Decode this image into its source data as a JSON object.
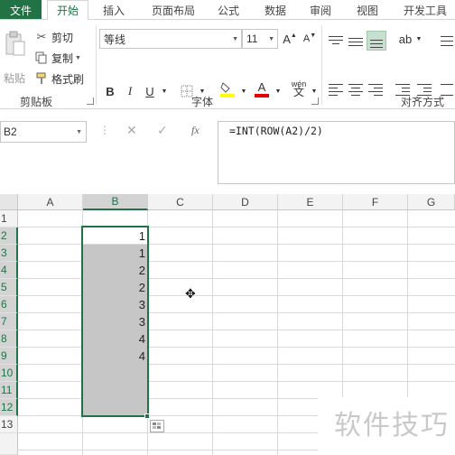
{
  "tabs": {
    "file": "文件",
    "items": [
      {
        "label": "开始",
        "active": true
      },
      {
        "label": "插入"
      },
      {
        "label": "页面布局"
      },
      {
        "label": "公式"
      },
      {
        "label": "数据"
      },
      {
        "label": "审阅"
      },
      {
        "label": "视图"
      },
      {
        "label": "开发工具"
      }
    ]
  },
  "clipboard": {
    "paste": "粘贴",
    "cut": "剪切",
    "copy": "复制",
    "format_painter": "格式刷",
    "group_label": "剪贴板"
  },
  "font": {
    "name": "等线",
    "size": "11",
    "grow": "A",
    "shrink": "A",
    "bold": "B",
    "italic": "I",
    "underline": "U",
    "phonetic": "wén",
    "group_label": "字体"
  },
  "alignment": {
    "group_label": "对齐方式"
  },
  "formula_bar": {
    "name_box": "B2",
    "cancel": "✕",
    "enter": "✓",
    "fx": "fx",
    "formula": "=INT(ROW(A2)/2)"
  },
  "sheet": {
    "columns": [
      "A",
      "B",
      "C",
      "D",
      "E",
      "F",
      "G"
    ],
    "rows": [
      "1",
      "2",
      "3",
      "4",
      "5",
      "6",
      "7",
      "8",
      "9",
      "10",
      "11",
      "12",
      "13"
    ],
    "b_values": [
      "1",
      "1",
      "2",
      "2",
      "3",
      "3",
      "4",
      "4"
    ]
  },
  "watermark": "软件技巧",
  "colors": {
    "accent": "#217346",
    "selection_fill": "#c6c6c6"
  }
}
